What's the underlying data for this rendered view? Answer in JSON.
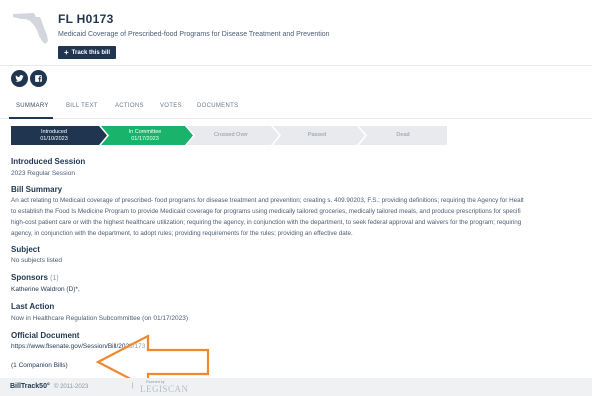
{
  "bill": {
    "id": "FL H0173",
    "title": "Medicaid Coverage of Prescribed-food Programs for Disease Treatment and Prevention",
    "track_button": "Track this bill",
    "state_icon": "florida-state-outline",
    "colors": {
      "brand": "#1f3550",
      "accent_green": "#19b36b",
      "arrow": "#f0892e"
    }
  },
  "social": {
    "twitter_icon": "twitter-icon",
    "facebook_icon": "facebook-icon"
  },
  "tabs": [
    "SUMMARY",
    "BILL TEXT",
    "ACTIONS",
    "VOTES",
    "DOCUMENTS"
  ],
  "progress": {
    "steps": [
      {
        "label": "Introduced",
        "date": "01/10/2023",
        "state": "complete"
      },
      {
        "label": "In Committee",
        "date": "01/17/2023",
        "state": "current"
      },
      {
        "label": "Crossed Over",
        "date": "",
        "state": "pending"
      },
      {
        "label": "Passed",
        "date": "",
        "state": "pending"
      },
      {
        "label": "Dead",
        "date": "",
        "state": "pending"
      }
    ]
  },
  "session": {
    "heading": "Introduced Session",
    "value": "2023 Regular Session"
  },
  "summary": {
    "heading": "Bill Summary",
    "lines": [
      "An act relating to Medicaid coverage of prescribed- food programs for disease treatment and prevention; creating s. 409.90203, F.S.; providing definitions; requiring the Agency for Healt",
      "to establish the Food Is Medicine Program to provide Medicaid coverage for programs using medically tailored groceries, medically tailored meals, and produce prescriptions for specifi",
      "high-cost patient care or with the highest healthcare utilization; requiring the agency, in conjunction with the department, to seek federal approval and waivers for the program; requiring",
      "agency, in conjunction with the department, to adopt rules; providing requirements for the rules; providing an effective date."
    ]
  },
  "subject": {
    "heading": "Subject",
    "value": "No subjects listed"
  },
  "sponsors": {
    "heading": "Sponsors",
    "count": "(1)",
    "value": "Katherine Waldron (D)*,"
  },
  "last_action": {
    "heading": "Last Action",
    "value": "Now in Healthcare Regulation Subcommittee (on 01/17/2023)"
  },
  "official_document": {
    "heading": "Official Document",
    "url": "https://www.flsenate.gov/Session/Bill/2023/173"
  },
  "companion": {
    "label": "(1 Companion Bills)"
  },
  "footer": {
    "brand": "BillTrack50°",
    "copyright": "© 2011-2023",
    "separator": "|",
    "powered_by": "Powered by",
    "logo_text": "LEGISCAN"
  }
}
